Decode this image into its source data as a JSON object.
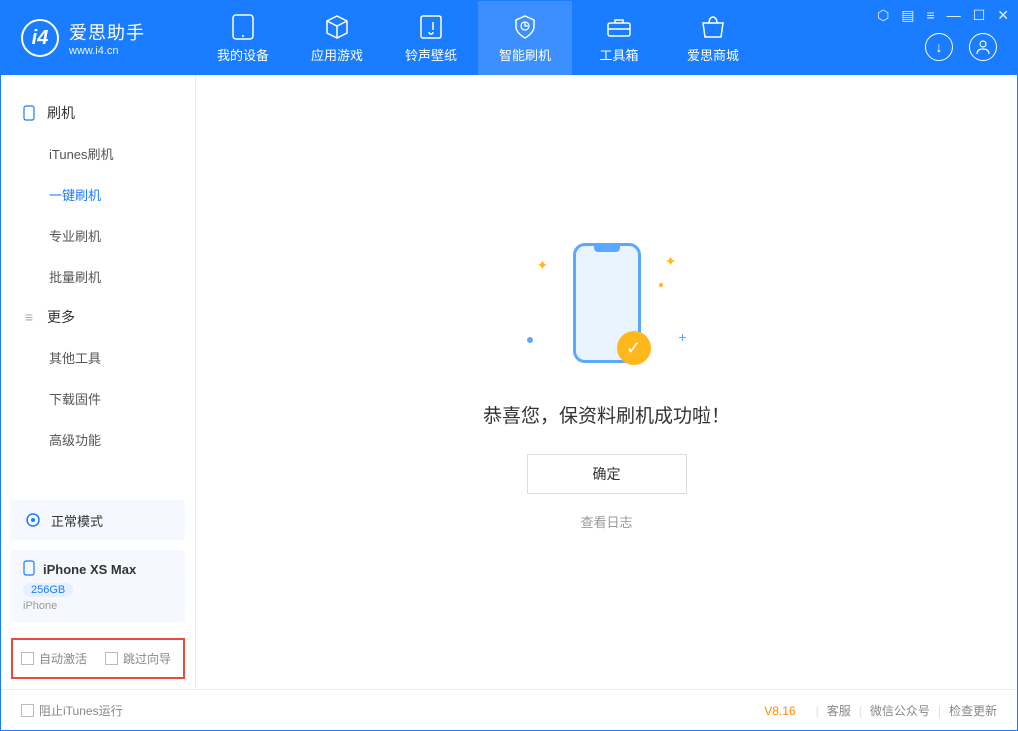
{
  "app": {
    "name": "爱思助手",
    "website": "www.i4.cn"
  },
  "nav": {
    "tabs": [
      {
        "label": "我的设备"
      },
      {
        "label": "应用游戏"
      },
      {
        "label": "铃声壁纸"
      },
      {
        "label": "智能刷机"
      },
      {
        "label": "工具箱"
      },
      {
        "label": "爱思商城"
      }
    ]
  },
  "sidebar": {
    "group1": {
      "title": "刷机"
    },
    "items1": [
      {
        "label": "iTunes刷机"
      },
      {
        "label": "一键刷机"
      },
      {
        "label": "专业刷机"
      },
      {
        "label": "批量刷机"
      }
    ],
    "group2": {
      "title": "更多"
    },
    "items2": [
      {
        "label": "其他工具"
      },
      {
        "label": "下载固件"
      },
      {
        "label": "高级功能"
      }
    ],
    "mode": "正常模式",
    "device": {
      "name": "iPhone XS Max",
      "storage": "256GB",
      "type": "iPhone"
    },
    "checks": {
      "auto_activate": "自动激活",
      "skip_guide": "跳过向导"
    }
  },
  "main": {
    "success_message": "恭喜您，保资料刷机成功啦！",
    "ok_button": "确定",
    "view_log": "查看日志"
  },
  "footer": {
    "block_itunes": "阻止iTunes运行",
    "version": "V8.16",
    "links": {
      "support": "客服",
      "wechat": "微信公众号",
      "update": "检查更新"
    }
  }
}
